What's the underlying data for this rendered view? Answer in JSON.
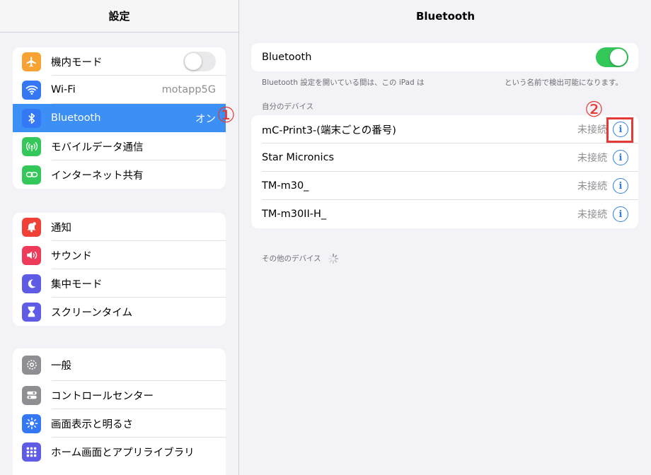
{
  "sidebar": {
    "title": "設定",
    "group1": [
      {
        "label": "機内モード",
        "color": "#f7a233",
        "icon": "airplane-icon"
      },
      {
        "label": "Wi-Fi",
        "value": "motapp5G",
        "color": "#3478f6",
        "icon": "wifi-icon"
      },
      {
        "label": "Bluetooth",
        "value": "オン",
        "color": "#3478f6",
        "icon": "bluetooth-icon"
      },
      {
        "label": "モバイルデータ通信",
        "color": "#34c759",
        "icon": "cellular-icon"
      },
      {
        "label": "インターネット共有",
        "color": "#34c759",
        "icon": "hotspot-icon"
      }
    ],
    "group2": [
      {
        "label": "通知",
        "color": "#ef4136",
        "icon": "bell-icon"
      },
      {
        "label": "サウンド",
        "color": "#ef3b5a",
        "icon": "speaker-icon"
      },
      {
        "label": "集中モード",
        "color": "#5e5ce6",
        "icon": "moon-icon"
      },
      {
        "label": "スクリーンタイム",
        "color": "#5e5ce6",
        "icon": "hourglass-icon"
      }
    ],
    "group3": [
      {
        "label": "一般",
        "color": "#8e8e93",
        "icon": "gear-icon"
      },
      {
        "label": "コントロールセンター",
        "color": "#8e8e93",
        "icon": "switches-icon"
      },
      {
        "label": "画面表示と明るさ",
        "color": "#3478f6",
        "icon": "sun-icon"
      },
      {
        "label": "ホーム画面とアプリライブラリ",
        "color": "#5e5ce6",
        "icon": "grid-icon"
      }
    ]
  },
  "annotations": {
    "one": "①",
    "two": "②"
  },
  "main": {
    "title": "Bluetooth",
    "toggle_label": "Bluetooth",
    "footnote_left": "Bluetooth 設定を開いている間は、この iPad は",
    "footnote_right": "という名前で検出可能になります。",
    "my_devices_label": "自分のデバイス",
    "devices": [
      {
        "name": "mC-Print3-(端末ごとの番号)",
        "status": "未接続",
        "info": "i"
      },
      {
        "name": "Star Micronics",
        "status": "未接続",
        "info": "i"
      },
      {
        "name": "TM-m30_",
        "status": "未接続",
        "info": "i"
      },
      {
        "name": "TM-m30II-H_",
        "status": "未接続",
        "info": "i"
      }
    ],
    "other_devices_label": "その他のデバイス"
  }
}
